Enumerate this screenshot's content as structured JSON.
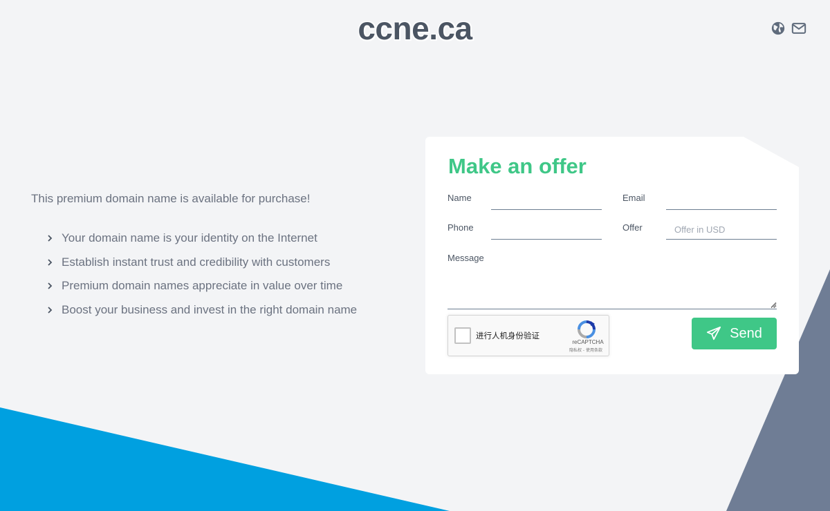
{
  "header": {
    "site_title": "ccne.ca",
    "icons": [
      "language-globe-icon",
      "email-envelope-icon"
    ]
  },
  "intro": {
    "text": "This premium domain name is available for purchase!",
    "features": [
      "Your domain name is your identity on the Internet",
      "Establish instant trust and credibility with customers",
      "Premium domain names appreciate in value over time",
      "Boost your business and invest in the right domain name"
    ]
  },
  "form": {
    "title": "Make an offer",
    "name_label": "Name",
    "email_label": "Email",
    "phone_label": "Phone",
    "offer_label": "Offer",
    "offer_placeholder": "Offer in USD",
    "message_label": "Message",
    "send_label": "Send"
  },
  "recaptcha": {
    "label": "进行人机身份验证",
    "brand": "reCAPTCHA",
    "links": "隐私权 - 使用条款"
  },
  "colors": {
    "accent": "#3fc787",
    "background": "#f3f4f6",
    "blue_shape": "#00a0e0",
    "slate_shape": "#6f7d95",
    "text": "#4b5563"
  }
}
